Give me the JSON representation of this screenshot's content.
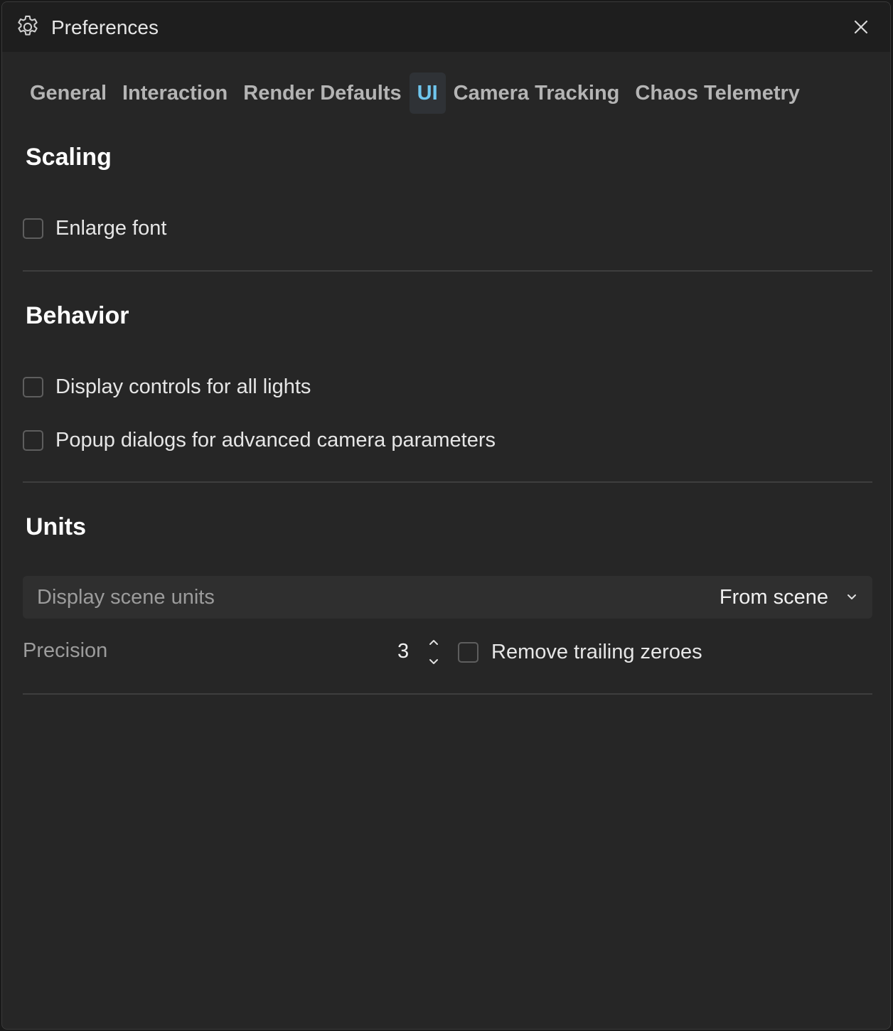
{
  "window": {
    "title": "Preferences"
  },
  "tabs": [
    {
      "label": "General",
      "active": false
    },
    {
      "label": "Interaction",
      "active": false
    },
    {
      "label": "Render Defaults",
      "active": false
    },
    {
      "label": "UI",
      "active": true
    },
    {
      "label": "Camera Tracking",
      "active": false
    },
    {
      "label": "Chaos Telemetry",
      "active": false
    }
  ],
  "scaling": {
    "title": "Scaling",
    "enlarge_font": {
      "label": "Enlarge font",
      "checked": false
    }
  },
  "behavior": {
    "title": "Behavior",
    "display_controls": {
      "label": "Display controls for all lights",
      "checked": false
    },
    "popup_dialogs": {
      "label": "Popup dialogs for advanced camera parameters",
      "checked": false
    }
  },
  "units": {
    "title": "Units",
    "scene_units": {
      "label": "Display scene units",
      "value": "From scene"
    },
    "precision": {
      "label": "Precision",
      "value": "3"
    },
    "remove_trailing": {
      "label": "Remove trailing zeroes",
      "checked": false
    }
  },
  "colors": {
    "accent": "#6fc6ee",
    "background": "#262626",
    "titlebar": "#1e1e1e"
  },
  "icons": {
    "title": "gear-icon",
    "close": "close-icon",
    "dropdown": "chevron-down-icon",
    "stepper_up": "chevron-up-icon",
    "stepper_down": "chevron-down-icon"
  }
}
